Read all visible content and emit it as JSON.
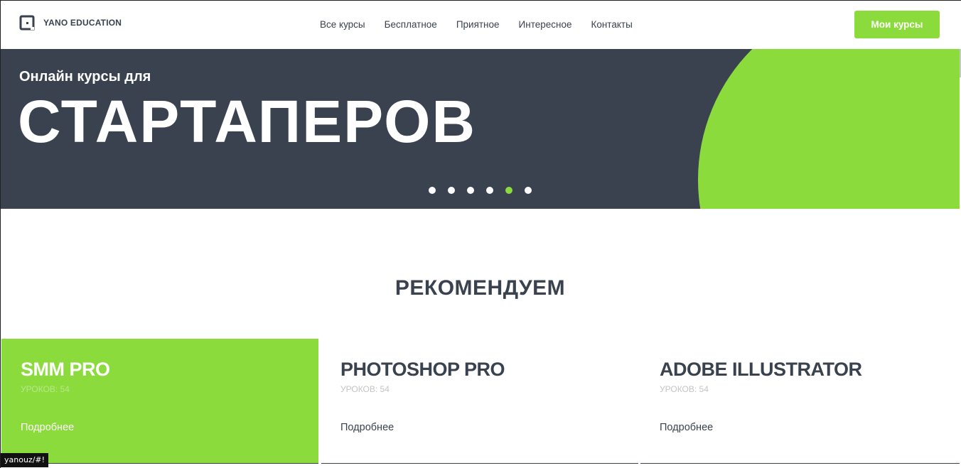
{
  "header": {
    "logo_text": "YANO EDUCATION",
    "nav": [
      "Все курсы",
      "Бесплатное",
      "Приятное",
      "Интересное",
      "Контакты"
    ],
    "cta_label": "Мои курсы"
  },
  "hero": {
    "subtitle": "Онлайн курсы для",
    "title": "СТАРТАПЕРОВ",
    "slides_count": 6,
    "active_slide": 5
  },
  "recommend": {
    "title": "РЕКОМЕНДУЕМ",
    "cards": [
      {
        "title": "SMM PRO",
        "lessons": "УРОКОВ: 54",
        "more": "Подробнее",
        "highlighted": true
      },
      {
        "title": "PHOTOSHOP PRO",
        "lessons": "УРОКОВ: 54",
        "more": "Подробнее",
        "highlighted": false
      },
      {
        "title": "ADOBE ILLUSTRATOR",
        "lessons": "УРОКОВ: 54",
        "more": "Подробнее",
        "highlighted": false
      }
    ]
  },
  "status_bar": {
    "url": "yanouz/#!"
  },
  "colors": {
    "accent": "#8cdb3c",
    "dark": "#39424e",
    "white": "#ffffff"
  },
  "icons": {
    "logo": "logo-icon"
  }
}
